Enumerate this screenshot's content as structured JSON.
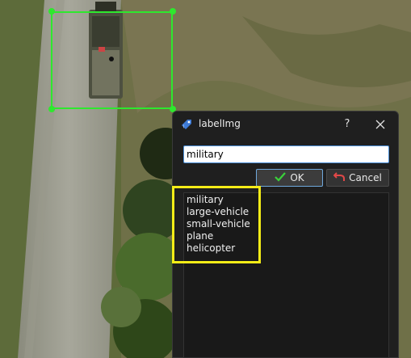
{
  "dialog": {
    "title": "labelImg",
    "help_label": "?",
    "input_value": "military",
    "ok_label": "OK",
    "cancel_label": "Cancel",
    "labels": [
      "military",
      "large-vehicle",
      "small-vehicle",
      "plane",
      "helicopter"
    ]
  },
  "colors": {
    "bbox": "#2ee82e",
    "highlight": "#f4ec17",
    "input_focus": "#4a8fd8",
    "dialog_bg": "#1f1f1f"
  },
  "icons": {
    "app": "labelimg-app-icon",
    "close": "close-icon",
    "ok": "checkmark-icon",
    "cancel": "undo-arrow-icon"
  }
}
